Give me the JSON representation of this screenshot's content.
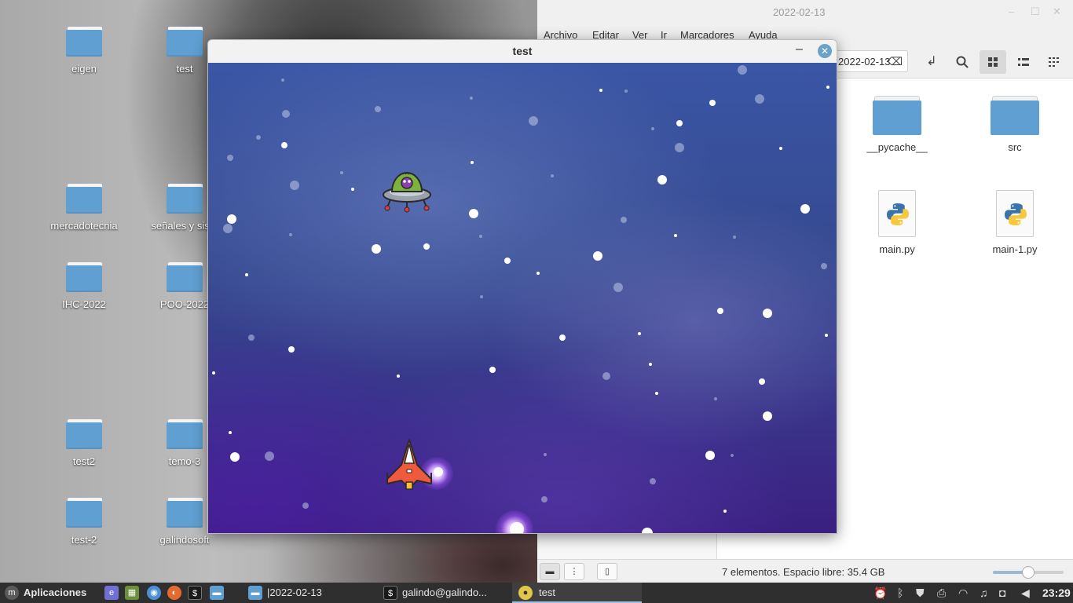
{
  "desktop": {
    "icons": [
      {
        "label": "eigen"
      },
      {
        "label": "test"
      },
      {
        "label": "mercadotecnia"
      },
      {
        "label": "señales y siste"
      },
      {
        "label": "IHC-2022"
      },
      {
        "label": "POO-2022"
      },
      {
        "label": "test2"
      },
      {
        "label": "temo-3"
      },
      {
        "label": "test-2"
      },
      {
        "label": "galindosoft"
      }
    ]
  },
  "file_manager": {
    "title": "2022-02-13",
    "window_buttons": {
      "minimize": "–",
      "maximize": "☐",
      "close": "✕"
    },
    "menu": [
      "Archivo",
      "Editar",
      "Ver",
      "Ir",
      "Marcadores",
      "Ayuda"
    ],
    "path_text": "2022-02-13",
    "toolbar_icons": [
      "clear-path-icon",
      "toggle-location-icon",
      "search-icon",
      "icon-view-icon",
      "list-view-icon",
      "compact-view-icon"
    ],
    "items": [
      {
        "name": "__pycache__",
        "type": "folder"
      },
      {
        "name": "src",
        "type": "folder"
      },
      {
        "name": "main.py",
        "type": "python"
      },
      {
        "name": "main-1.py",
        "type": "python"
      }
    ],
    "status_text": "7 elementos. Espacio libre: 35.4 GB",
    "zoom_level": 0.5
  },
  "game_window": {
    "title": "test",
    "sprites": [
      "alien-ufo",
      "player-spaceship"
    ]
  },
  "taskbar": {
    "menu_label": "Aplicaciones",
    "windows": [
      {
        "label": "|2022-02-13"
      },
      {
        "label": "galindo@galindo..."
      },
      {
        "label": "test"
      }
    ],
    "clock": "23:29",
    "colors": {
      "background": "#2f2f2f",
      "active_underline": "#9fbfe0"
    }
  }
}
